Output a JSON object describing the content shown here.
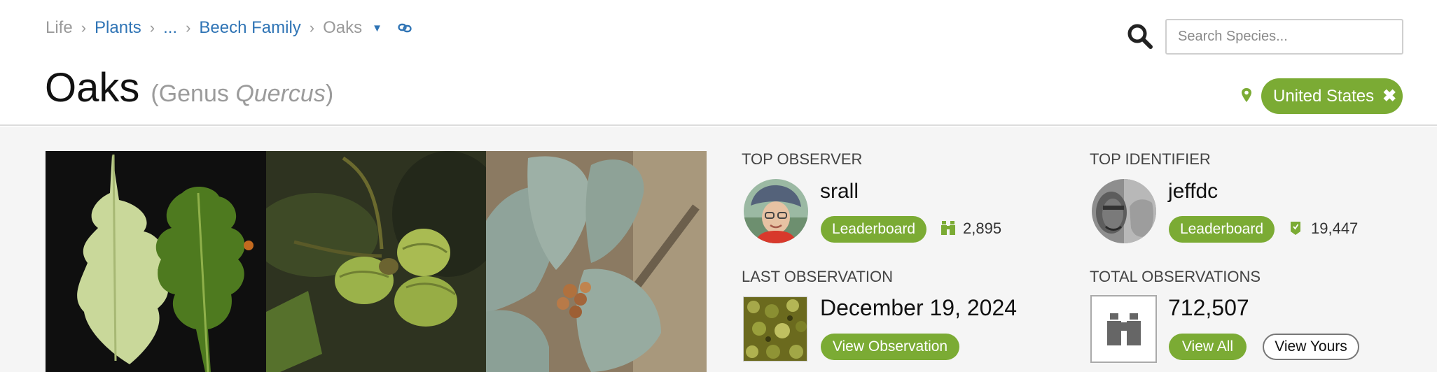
{
  "breadcrumb": {
    "life": "Life",
    "plants": "Plants",
    "ellipsis": "...",
    "beech_family": "Beech Family",
    "current": "Oaks",
    "separator": "›"
  },
  "search": {
    "placeholder": "Search Species..."
  },
  "taxon": {
    "common_name": "Oaks",
    "rank_prefix": "(Genus ",
    "scientific_name": "Quercus",
    "rank_suffix": ")"
  },
  "place_filter": {
    "label": "United States",
    "close": "✖"
  },
  "top_observer": {
    "heading": "TOP OBSERVER",
    "name": "srall",
    "leaderboard_label": "Leaderboard",
    "count": "2,895"
  },
  "top_identifier": {
    "heading": "TOP IDENTIFIER",
    "name": "jeffdc",
    "leaderboard_label": "Leaderboard",
    "count": "19,447"
  },
  "last_observation": {
    "heading": "LAST OBSERVATION",
    "date": "December 19, 2024",
    "button_label": "View Observation"
  },
  "total_observations": {
    "heading": "TOTAL OBSERVATIONS",
    "count": "712,507",
    "view_all_label": "View All",
    "view_yours_label": "View Yours"
  },
  "colors": {
    "accent_green": "#7bab34",
    "link_blue": "#2f74b5",
    "panel_bg": "#f5f5f5"
  },
  "icons": {
    "search": "search-icon",
    "pin": "map-pin-icon",
    "binoculars": "binoculars-icon",
    "identification": "identification-icon",
    "link": "link-icon"
  }
}
